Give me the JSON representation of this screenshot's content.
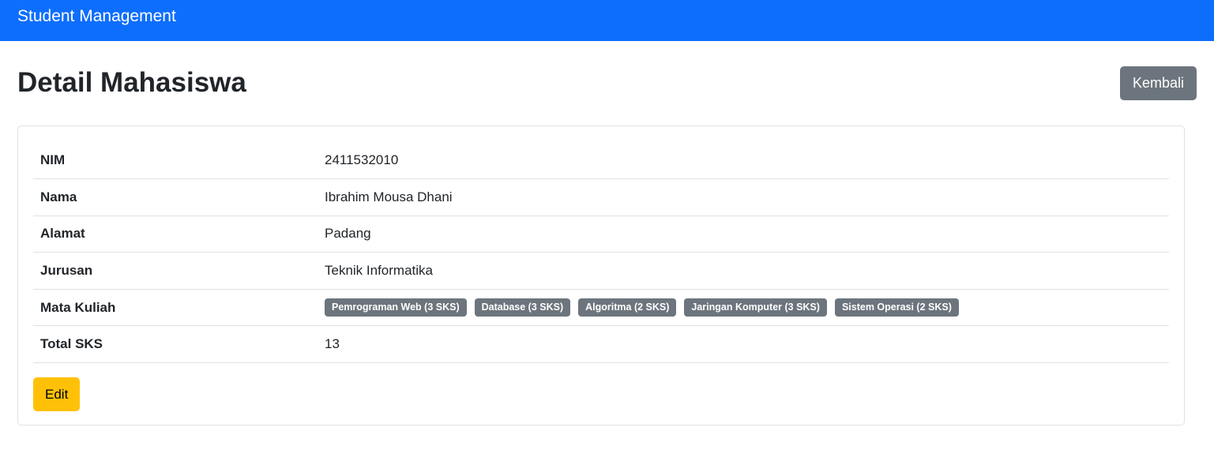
{
  "navbar": {
    "brand": "Student Management"
  },
  "header": {
    "title": "Detail Mahasiswa",
    "back_label": "Kembali"
  },
  "detail": {
    "rows": [
      {
        "label": "NIM",
        "value": "2411532010"
      },
      {
        "label": "Nama",
        "value": "Ibrahim Mousa Dhani"
      },
      {
        "label": "Alamat",
        "value": "Padang"
      },
      {
        "label": "Jurusan",
        "value": "Teknik Informatika"
      },
      {
        "label": "Mata Kuliah",
        "value": ""
      },
      {
        "label": "Total SKS",
        "value": "13"
      }
    ],
    "courses": [
      "Pemrograman Web (3 SKS)",
      "Database (3 SKS)",
      "Algoritma (2 SKS)",
      "Jaringan Komputer (3 SKS)",
      "Sistem Operasi (2 SKS)"
    ]
  },
  "actions": {
    "edit_label": "Edit"
  },
  "colors": {
    "navbar": "#0d6efd",
    "secondary": "#6c757d",
    "warning": "#ffc107",
    "text": "#212529",
    "border": "#dee2e6"
  }
}
